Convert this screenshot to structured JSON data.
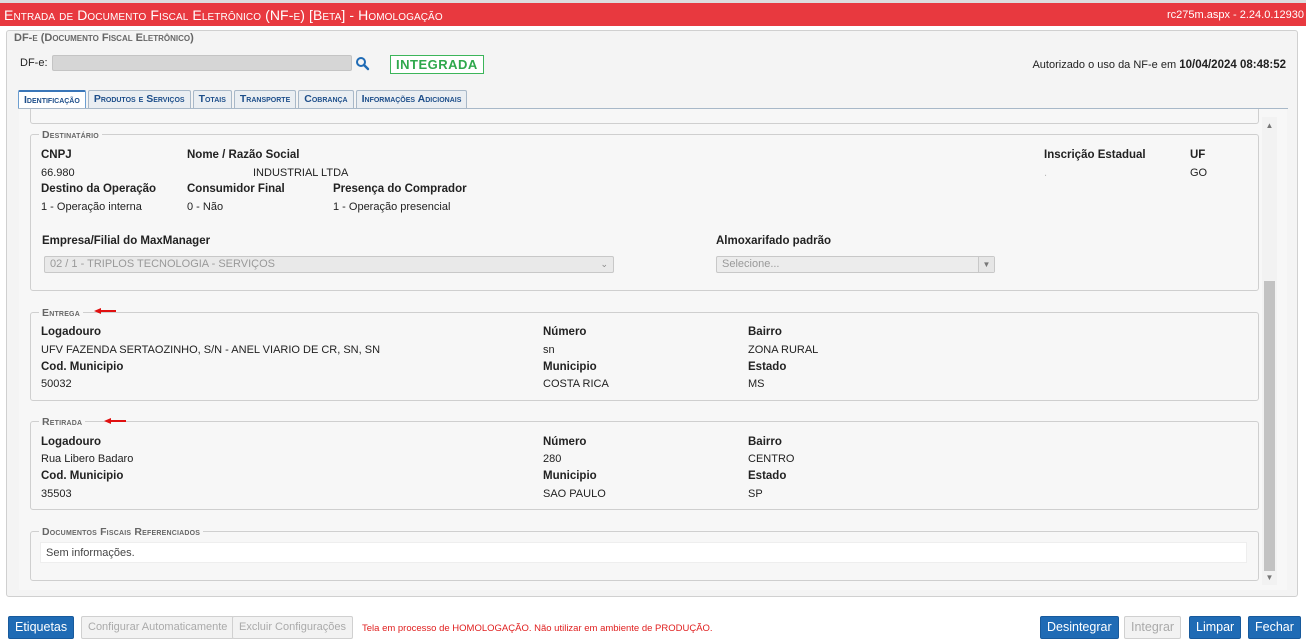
{
  "window": {
    "title": "Entrada de Documento Fiscal Eletrônico (NF-e) [Beta]  - Homologação",
    "version": "rc275m.aspx - 2.24.0.12930"
  },
  "panel": {
    "legend": "DF-e (Documento Fiscal Eletrônico)",
    "dfe_label": "DF-e:",
    "dfe_value": "",
    "status_badge": "INTEGRADA",
    "auth_prefix": "Autorizado o uso da NF-e em ",
    "auth_datetime": "10/04/2024 08:48:52"
  },
  "tabs": [
    {
      "label": "Identificação",
      "active": true
    },
    {
      "label": "Produtos e Serviços",
      "active": false
    },
    {
      "label": "Totais",
      "active": false
    },
    {
      "label": "Transporte",
      "active": false
    },
    {
      "label": "Cobrança",
      "active": false
    },
    {
      "label": "Informações Adicionais",
      "active": false
    }
  ],
  "destinatario": {
    "legend": "Destinatário",
    "cnpj_label": "CNPJ",
    "cnpj_value": "66.980",
    "nome_label": "Nome / Razão Social",
    "nome_value": "INDUSTRIAL LTDA",
    "ie_label": "Inscrição Estadual",
    "ie_value": ".",
    "uf_label": "UF",
    "uf_value": "GO",
    "destino_label": "Destino da Operação",
    "destino_value": "1 - Operação interna",
    "consumidor_label": "Consumidor Final",
    "consumidor_value": "0 - Não",
    "presenca_label": "Presença do Comprador",
    "presenca_value": "1 - Operação presencial",
    "empresa_label": "Empresa/Filial do MaxManager",
    "empresa_value": "02 / 1 - TRIPLOS TECNOLOGIA - SERVIÇOS",
    "almox_label": "Almoxarifado padrão",
    "almox_placeholder": "Selecione..."
  },
  "entrega": {
    "legend": "Entrega",
    "logradouro_label": "Logadouro",
    "logradouro_value": "UFV FAZENDA SERTAOZINHO, S/N - ANEL VIARIO DE CR, SN, SN",
    "numero_label": "Número",
    "numero_value": "sn",
    "bairro_label": "Bairro",
    "bairro_value": "ZONA RURAL",
    "codmun_label": "Cod. Municipio",
    "codmun_value": "50032",
    "municipio_label": "Municipio",
    "municipio_value": "COSTA RICA",
    "estado_label": "Estado",
    "estado_value": "MS"
  },
  "retirada": {
    "legend": "Retirada",
    "logradouro_label": "Logadouro",
    "logradouro_value": "Rua Libero Badaro",
    "numero_label": "Número",
    "numero_value": "280",
    "bairro_label": "Bairro",
    "bairro_value": "CENTRO",
    "codmun_label": "Cod. Municipio",
    "codmun_value": "35503",
    "municipio_label": "Municipio",
    "municipio_value": "SAO PAULO",
    "estado_label": "Estado",
    "estado_value": "SP"
  },
  "referenciados": {
    "legend": "Documentos Fiscais Referenciados",
    "note": "Sem informações."
  },
  "footer": {
    "etiquetas": "Etiquetas",
    "config_auto": "Configurar Automaticamente",
    "excluir_config": "Excluir Configurações",
    "warning": "Tela em processo de HOMOLOGAÇÃO. Não utilizar em ambiente de PRODUÇÃO.",
    "desintegrar": "Desintegrar",
    "integrar": "Integrar",
    "limpar": "Limpar",
    "fechar": "Fechar"
  },
  "colors": {
    "title_bar": "#e8393f",
    "primary_button": "#1f6bb5",
    "status_green": "#2fa84c",
    "warning_red": "#e02020"
  }
}
